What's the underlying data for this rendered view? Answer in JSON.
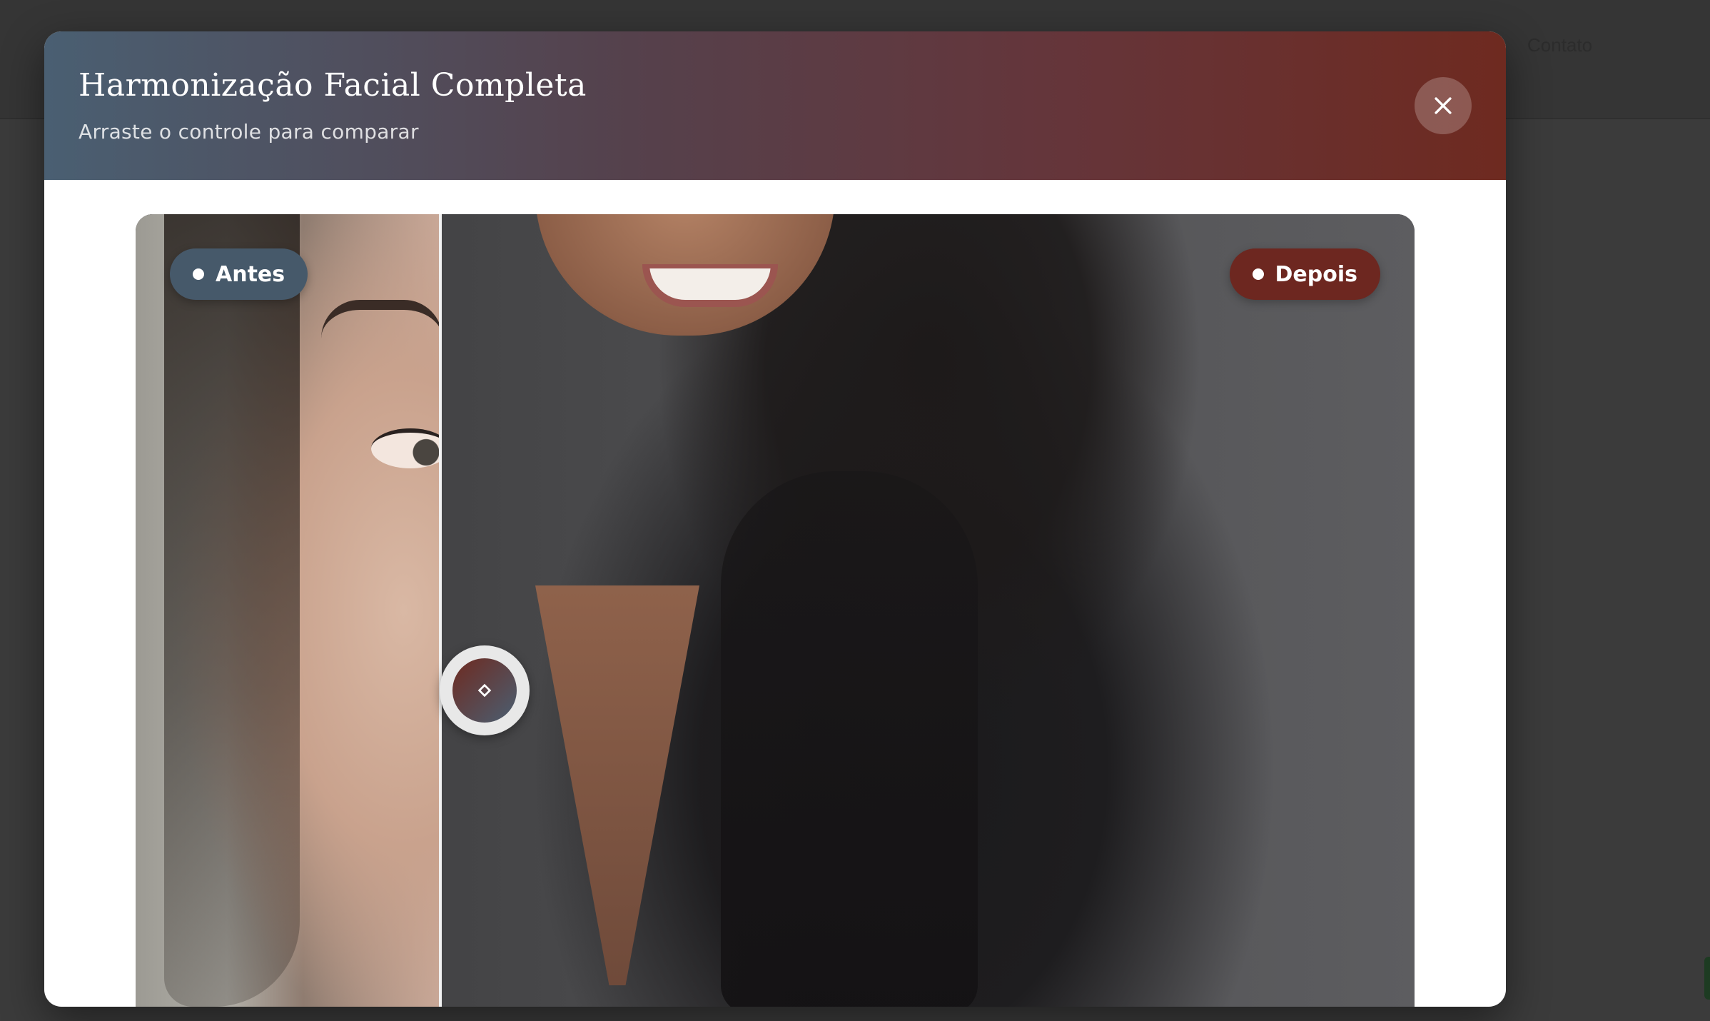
{
  "background": {
    "nav_link": "Contato"
  },
  "modal": {
    "title": "Harmonização Facial Completa",
    "subtitle": "Arraste o controle para comparar",
    "close_icon": "close-icon"
  },
  "comparison": {
    "before_label": "Antes",
    "after_label": "Depois",
    "handle_icon": "diamond-icon",
    "divider_position_percent": 23.8
  },
  "colors": {
    "header_gradient_start": "#4a5f72",
    "header_gradient_end": "#6e2a20",
    "before_badge": "#46596a",
    "after_badge": "#6d2720"
  }
}
